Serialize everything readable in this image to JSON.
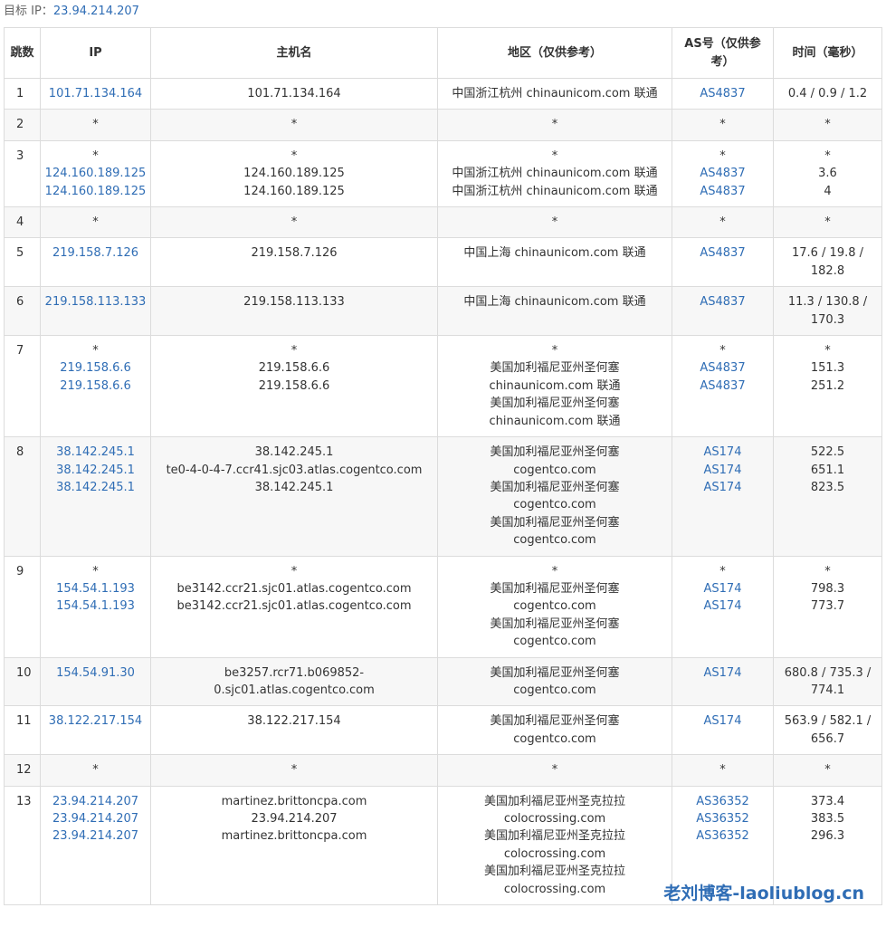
{
  "target": {
    "label": "目标 IP：",
    "ip": "23.94.214.207"
  },
  "columns": {
    "hop": "跳数",
    "ip": "IP",
    "host": "主机名",
    "region": "地区（仅供参考）",
    "as": "AS号（仅供参考）",
    "time": "时间（毫秒）"
  },
  "rows": [
    {
      "hop": "1",
      "ip": [
        "101.71.134.164"
      ],
      "host": [
        "101.71.134.164"
      ],
      "region": [
        "中国浙江杭州 chinaunicom.com 联通"
      ],
      "as": [
        "AS4837"
      ],
      "time": [
        "0.4 / 0.9 / 1.2"
      ]
    },
    {
      "hop": "2",
      "ip": [
        "*"
      ],
      "host": [
        "*"
      ],
      "region": [
        "*"
      ],
      "as": [
        "*"
      ],
      "time": [
        "*"
      ]
    },
    {
      "hop": "3",
      "ip": [
        "*",
        "124.160.189.125",
        "124.160.189.125"
      ],
      "host": [
        "*",
        "124.160.189.125",
        "124.160.189.125"
      ],
      "region": [
        "*",
        "中国浙江杭州 chinaunicom.com 联通",
        "中国浙江杭州 chinaunicom.com 联通"
      ],
      "as": [
        "*",
        "AS4837",
        "AS4837"
      ],
      "time": [
        "*",
        "3.6",
        "4"
      ]
    },
    {
      "hop": "4",
      "ip": [
        "*"
      ],
      "host": [
        "*"
      ],
      "region": [
        "*"
      ],
      "as": [
        "*"
      ],
      "time": [
        "*"
      ]
    },
    {
      "hop": "5",
      "ip": [
        "219.158.7.126"
      ],
      "host": [
        "219.158.7.126"
      ],
      "region": [
        "中国上海 chinaunicom.com 联通"
      ],
      "as": [
        "AS4837"
      ],
      "time": [
        "17.6 / 19.8 / 182.8"
      ]
    },
    {
      "hop": "6",
      "ip": [
        "219.158.113.133"
      ],
      "host": [
        "219.158.113.133"
      ],
      "region": [
        "中国上海 chinaunicom.com 联通"
      ],
      "as": [
        "AS4837"
      ],
      "time": [
        "11.3 / 130.8 / 170.3"
      ]
    },
    {
      "hop": "7",
      "ip": [
        "*",
        "219.158.6.6",
        "219.158.6.6"
      ],
      "host": [
        "*",
        "219.158.6.6",
        "219.158.6.6"
      ],
      "region": [
        "*",
        "美国加利福尼亚州圣何塞",
        "chinaunicom.com 联通",
        "美国加利福尼亚州圣何塞",
        "chinaunicom.com 联通"
      ],
      "as": [
        "*",
        "AS4837",
        "AS4837"
      ],
      "time": [
        "*",
        "151.3",
        "251.2"
      ]
    },
    {
      "hop": "8",
      "ip": [
        "38.142.245.1",
        "38.142.245.1",
        "38.142.245.1"
      ],
      "host": [
        "38.142.245.1",
        "te0-4-0-4-7.ccr41.sjc03.atlas.cogentco.com",
        "38.142.245.1"
      ],
      "region": [
        "美国加利福尼亚州圣何塞",
        "cogentco.com",
        "美国加利福尼亚州圣何塞",
        "cogentco.com",
        "美国加利福尼亚州圣何塞",
        "cogentco.com"
      ],
      "as": [
        "AS174",
        "AS174",
        "AS174"
      ],
      "time": [
        "522.5",
        "651.1",
        "823.5"
      ]
    },
    {
      "hop": "9",
      "ip": [
        "*",
        "154.54.1.193",
        "154.54.1.193"
      ],
      "host": [
        "*",
        "be3142.ccr21.sjc01.atlas.cogentco.com",
        "be3142.ccr21.sjc01.atlas.cogentco.com"
      ],
      "region": [
        "*",
        "美国加利福尼亚州圣何塞",
        "cogentco.com",
        "美国加利福尼亚州圣何塞",
        "cogentco.com"
      ],
      "as": [
        "*",
        "AS174",
        "AS174"
      ],
      "time": [
        "*",
        "798.3",
        "773.7"
      ]
    },
    {
      "hop": "10",
      "ip": [
        "154.54.91.30"
      ],
      "host": [
        "be3257.rcr71.b069852-0.sjc01.atlas.cogentco.com"
      ],
      "region": [
        "美国加利福尼亚州圣何塞",
        "cogentco.com"
      ],
      "as": [
        "AS174"
      ],
      "time": [
        "680.8 / 735.3 / 774.1"
      ]
    },
    {
      "hop": "11",
      "ip": [
        "38.122.217.154"
      ],
      "host": [
        "38.122.217.154"
      ],
      "region": [
        "美国加利福尼亚州圣何塞",
        "cogentco.com"
      ],
      "as": [
        "AS174"
      ],
      "time": [
        "563.9 / 582.1 / 656.7"
      ]
    },
    {
      "hop": "12",
      "ip": [
        "*"
      ],
      "host": [
        "*"
      ],
      "region": [
        "*"
      ],
      "as": [
        "*"
      ],
      "time": [
        "*"
      ]
    },
    {
      "hop": "13",
      "ip": [
        "23.94.214.207",
        "23.94.214.207",
        "23.94.214.207"
      ],
      "host": [
        "martinez.brittoncpa.com",
        "23.94.214.207",
        "martinez.brittoncpa.com"
      ],
      "region": [
        "美国加利福尼亚州圣克拉拉",
        "colocrossing.com",
        "美国加利福尼亚州圣克拉拉",
        "colocrossing.com",
        "美国加利福尼亚州圣克拉拉",
        "colocrossing.com"
      ],
      "as": [
        "AS36352",
        "AS36352",
        "AS36352"
      ],
      "time": [
        "373.4",
        "383.5",
        "296.3"
      ]
    }
  ],
  "colors": {
    "link": "#2f6db5",
    "border": "#dcdcdc",
    "stripe": "#f7f7f7"
  },
  "watermark": "老刘博客-laoliublog.cn"
}
